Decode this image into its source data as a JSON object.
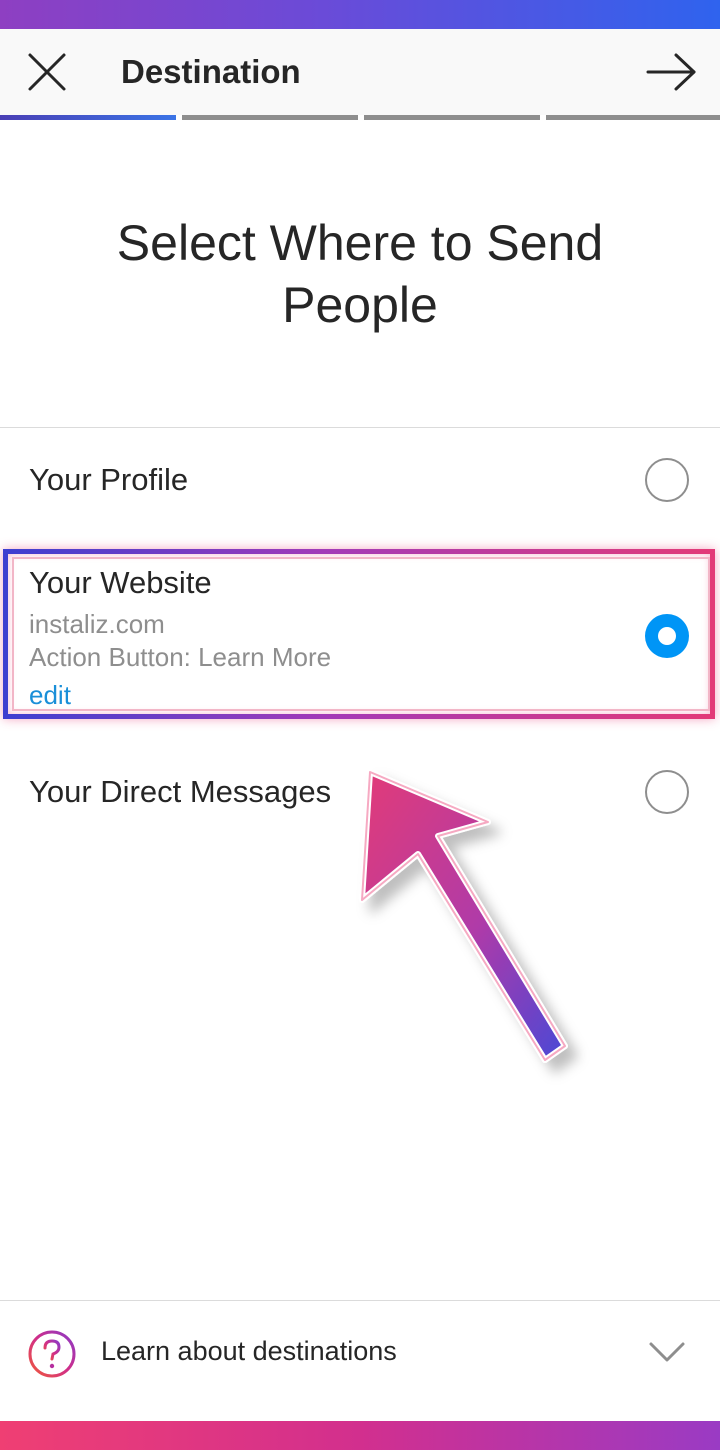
{
  "header": {
    "title": "Destination",
    "close_icon": "close-icon",
    "next_icon": "arrow-right-icon"
  },
  "progress": {
    "current_step": 1,
    "total_steps": 4
  },
  "heading": "Select Where to Send People",
  "options": [
    {
      "label": "Your Profile",
      "selected": false
    },
    {
      "label": "Your Website",
      "url": "instaliz.com",
      "action_button": "Action Button: Learn More",
      "edit_label": "edit",
      "selected": true
    },
    {
      "label": "Your Direct Messages",
      "selected": false
    }
  ],
  "footer": {
    "help_label": "Learn about destinations",
    "help_icon": "question-circle-icon",
    "expand_icon": "chevron-down-icon"
  },
  "colors": {
    "accent_blue": "#0095f6",
    "link_blue": "#1a8fd8",
    "annotation_pink": "#e23a78",
    "annotation_purple": "#6a3fd0"
  }
}
